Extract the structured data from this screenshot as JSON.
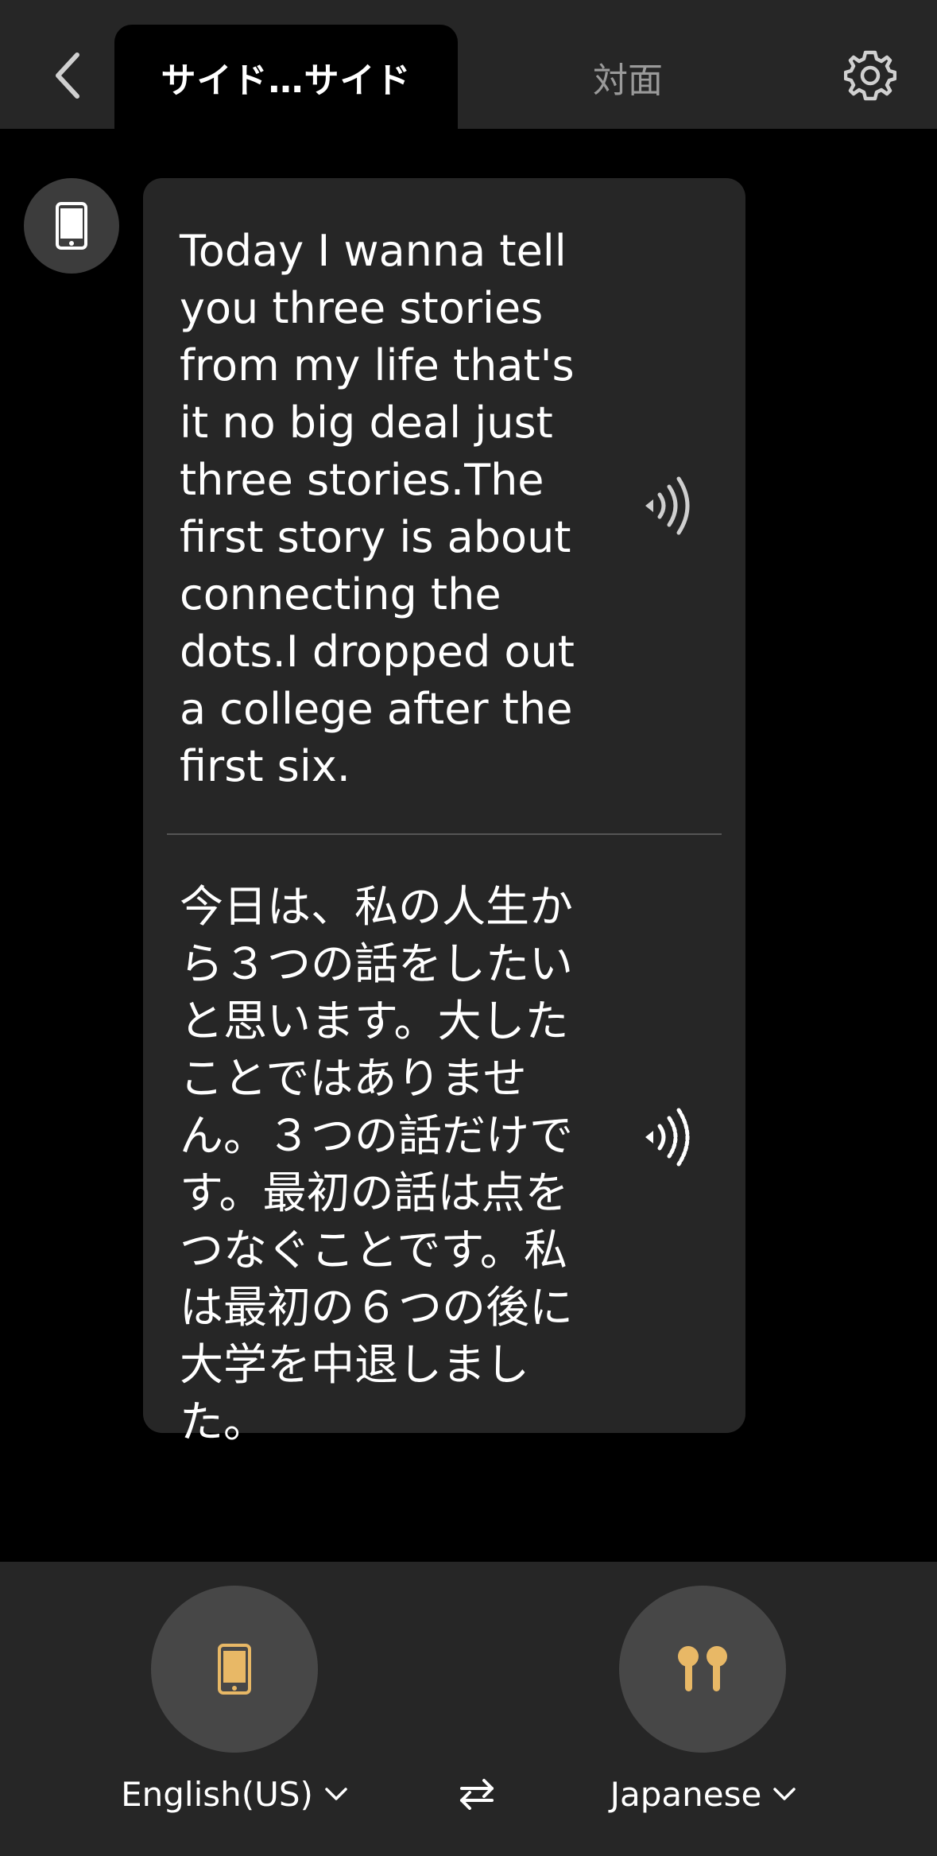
{
  "header": {
    "tabs": [
      {
        "label": "サイド…サイド",
        "active": true
      },
      {
        "label": "対面",
        "active": false
      }
    ]
  },
  "conversation": {
    "source_text": "Today I wanna tell you three stories from my life that's it no big deal just three stories.The first story is about connecting the dots.I dropped out a college after the first six.",
    "translated_text": "今日は、私の人生から３つの話をしたいと思います。大したことではありません。３つの話だけです。最初の話は点をつなぐことです。私は最初の６つの後に大学を中退しました。"
  },
  "footer": {
    "source_language": "English(US)",
    "target_language": "Japanese"
  },
  "colors": {
    "accent": "#E8B866",
    "header_bg": "#262626",
    "bubble_bg": "#262626",
    "mic_bg": "#474747"
  },
  "icons": [
    "back-chevron-icon",
    "gear-icon",
    "phone-icon",
    "speaker-icon",
    "earbuds-icon",
    "swap-icon",
    "chevron-down-icon"
  ]
}
